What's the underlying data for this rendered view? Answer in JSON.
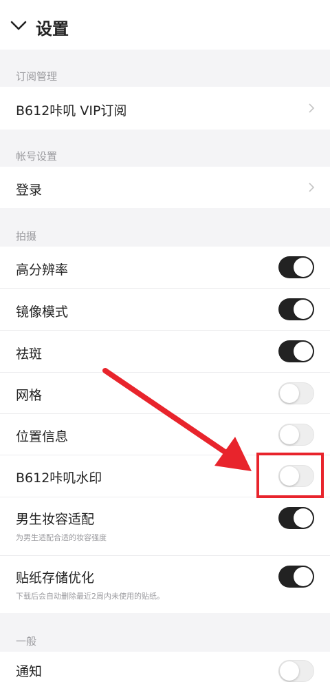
{
  "header": {
    "title": "设置",
    "back_icon": "chevron-down-icon"
  },
  "sections": {
    "subscription": {
      "title": "订阅管理",
      "items": [
        {
          "label": "B612咔叽 VIP订阅",
          "icon": "chevron-right-icon"
        }
      ]
    },
    "account": {
      "title": "帐号设置",
      "items": [
        {
          "label": "登录",
          "icon": "chevron-right-icon"
        }
      ]
    },
    "shooting": {
      "title": "拍摄",
      "items": [
        {
          "label": "高分辨率",
          "on": true
        },
        {
          "label": "镜像模式",
          "on": true
        },
        {
          "label": "祛斑",
          "on": true
        },
        {
          "label": "网格",
          "on": false
        },
        {
          "label": "位置信息",
          "on": false
        },
        {
          "label": "B612咔叽水印",
          "on": false
        },
        {
          "label": "男生妆容适配",
          "sub": "为男生适配合适的妆容强度",
          "on": true
        },
        {
          "label": "贴纸存储优化",
          "sub": "下载后会自动删除最近2周内未使用的贴纸。",
          "on": true
        }
      ]
    },
    "general": {
      "title": "一般",
      "items": [
        {
          "label": "通知",
          "on": false
        }
      ]
    }
  },
  "colors": {
    "toggle_on": "#222222",
    "toggle_off": "#eeeeee",
    "section_bg": "#f4f4f6",
    "annotation_red": "#e8242c"
  }
}
